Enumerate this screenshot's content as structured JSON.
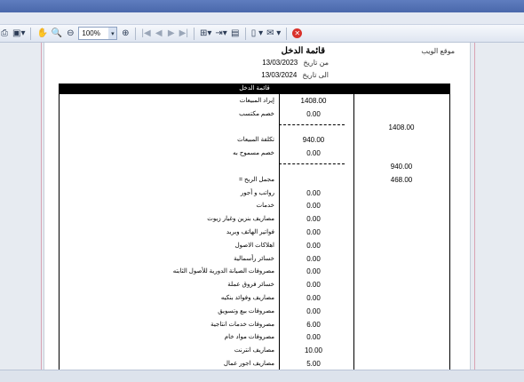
{
  "toolbar": {
    "zoom": "100%"
  },
  "report": {
    "title": "قائمة الدخل",
    "site_label": "موقع الويب",
    "from_label": "من تاريخ",
    "from_date": "13/03/2023",
    "to_label": "الى تاريخ",
    "to_date": "13/03/2024",
    "table_header": "قائمة الدخل",
    "rows": [
      {
        "label": "إيراد المبيعات",
        "value": "1408.00",
        "total": ""
      },
      {
        "label": "خصم مكتسب",
        "value": "0.00",
        "total": ""
      },
      {
        "label": "",
        "value": "",
        "total": "1408.00"
      },
      {
        "label": "تكلفة المبيعات",
        "value": "940.00",
        "total": ""
      },
      {
        "label": "خصم مسموح به",
        "value": "0.00",
        "total": ""
      },
      {
        "label": "",
        "value": "",
        "total": "940.00"
      },
      {
        "label": "= مجمل الربح",
        "value": "",
        "total": "468.00"
      },
      {
        "label": "رواتب و أجور",
        "value": "0.00",
        "total": ""
      },
      {
        "label": "خدمات",
        "value": "0.00",
        "total": ""
      },
      {
        "label": "مصاريف بنزين وغيار زيوت",
        "value": "0.00",
        "total": ""
      },
      {
        "label": "فواتير الهاتف وبريد",
        "value": "0.00",
        "total": ""
      },
      {
        "label": "اهلاكات الاصول",
        "value": "0.00",
        "total": ""
      },
      {
        "label": "خسائر رأسمالية",
        "value": "0.00",
        "total": ""
      },
      {
        "label": "مصروفات الصيانة الدورية للأصول الثابته",
        "value": "0.00",
        "total": ""
      },
      {
        "label": "خسائر فروق عملة",
        "value": "0.00",
        "total": ""
      },
      {
        "label": "مصاريف وفوائد بنكيه",
        "value": "0.00",
        "total": ""
      },
      {
        "label": "مصروفات بيع وتسويق",
        "value": "0.00",
        "total": ""
      },
      {
        "label": "مصروفات خدمات انتاجية",
        "value": "6.00",
        "total": ""
      },
      {
        "label": "مصروفات مواد خام",
        "value": "0.00",
        "total": ""
      },
      {
        "label": "مصاريف انترنت",
        "value": "10.00",
        "total": ""
      },
      {
        "label": "مصاريف اجور عمال",
        "value": "5.00",
        "total": ""
      }
    ]
  }
}
